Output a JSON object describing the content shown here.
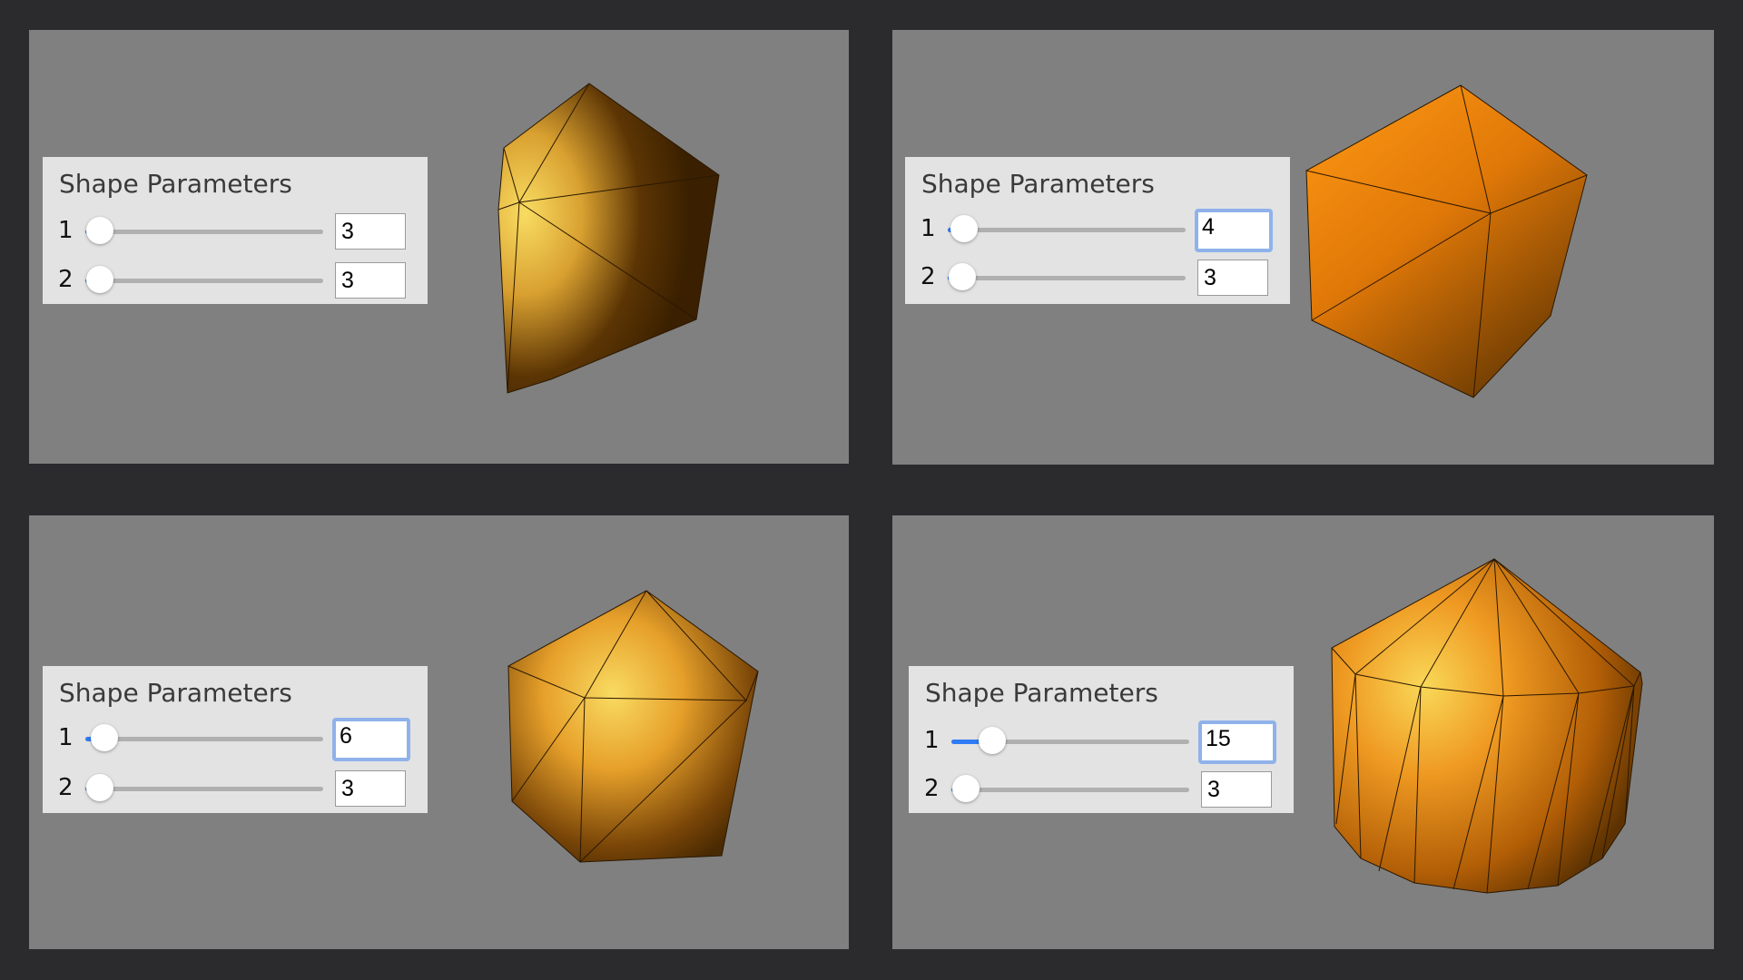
{
  "panel_title": "Shape Parameters",
  "panels": [
    {
      "rows": [
        {
          "label": "1",
          "value": "3",
          "slider_fraction": 0.06
        },
        {
          "label": "2",
          "value": "3",
          "slider_fraction": 0.06
        }
      ],
      "focused_field": 0
    },
    {
      "rows": [
        {
          "label": "1",
          "value": "4",
          "slider_fraction": 0.07
        },
        {
          "label": "2",
          "value": "3",
          "slider_fraction": 0.06
        }
      ],
      "focused_field": 1
    },
    {
      "rows": [
        {
          "label": "1",
          "value": "6",
          "slider_fraction": 0.08
        },
        {
          "label": "2",
          "value": "3",
          "slider_fraction": 0.06
        }
      ],
      "focused_field": 1
    },
    {
      "rows": [
        {
          "label": "1",
          "value": "15",
          "slider_fraction": 0.17
        },
        {
          "label": "2",
          "value": "3",
          "slider_fraction": 0.06
        }
      ],
      "focused_field": 1
    }
  ],
  "colors": {
    "background": "#2b2b2e",
    "viewport": "#808080",
    "panel": "#e3e3e3",
    "slider_accent": "#2f7cf6",
    "focus_ring": "#8fb2ea",
    "mesh_orange": "#f08a10",
    "mesh_highlight": "#f7d75a",
    "mesh_shadow": "#3e2200"
  }
}
